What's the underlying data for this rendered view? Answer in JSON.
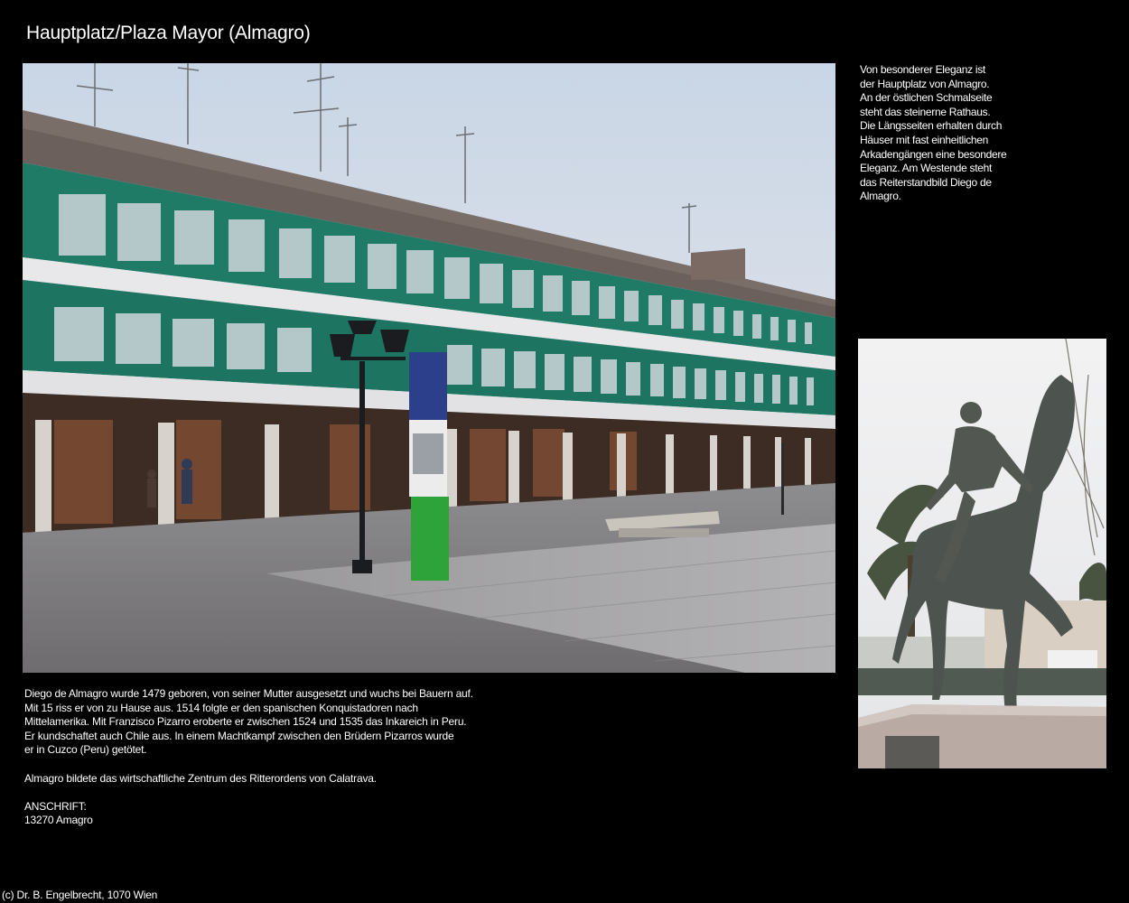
{
  "page": {
    "title": "Hauptplatz/Plaza Mayor (Almagro)"
  },
  "side_text": [
    "Von besonderer Eleganz ist",
    "der Hauptplatz von Almagro.",
    "An der östlichen Schmalseite",
    "steht das steinerne Rathaus.",
    "Die Längsseiten erhalten durch",
    "Häuser mit fast einheitlichen",
    "Arkadengängen eine besondere",
    "Eleganz. Am Westende steht",
    "das Reiterstandbild Diego de",
    "Almagro."
  ],
  "body_text": [
    "Diego de Almagro wurde 1479 geboren, von seiner Mutter ausgesetzt und wuchs bei Bauern auf.",
    "Mit 15 riss er von zu Hause aus. 1514 folgte er den spanischen Konquistadoren nach",
    "Mittelamerika. Mit Franzisco Pizarro eroberte er zwischen 1524 und 1535 das Inkareich in Peru.",
    "Er kundschaftet auch Chile aus. In einem Machtkampf zwischen den Brüdern Pizarros wurde",
    "er in Cuzco (Peru) getötet.",
    "",
    "Almagro bildete das wirtschaftliche Zentrum des Ritterordens von Calatrava.",
    "",
    "ANSCHRIFT:",
    "13270 Amagro"
  ],
  "footer": {
    "copyright": "(c) Dr. B. Engelbrecht, 1070 Wien"
  },
  "colors": {
    "background": "#000000",
    "text": "#ffffff",
    "facade_green": "#1f7a66",
    "sky": "#dfe6ef"
  }
}
